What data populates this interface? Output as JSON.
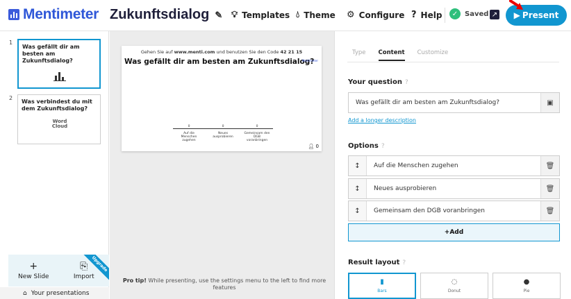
{
  "header": {
    "logo_text": "Mentimeter",
    "presentation_title": "Zukunftsdialog",
    "nav": {
      "templates": "Templates",
      "theme": "Theme",
      "configure": "Configure",
      "help": "Help"
    },
    "saved_label": "Saved",
    "present_label": "Present"
  },
  "sidebar": {
    "slides": [
      {
        "number": "1",
        "title": "Was gefällt dir am besten am Zukunftsdialog?"
      },
      {
        "number": "2",
        "title": "Was verbindest du mit dem Zukunftsdialog?",
        "wordcloud_label": "Word Cloud"
      }
    ],
    "new_slide": "New Slide",
    "import": "Import",
    "upgrade": "Upgrade",
    "your_presentations": "Your presentations"
  },
  "slide_preview": {
    "join_prefix": "Gehen Sie auf ",
    "join_url": "www.menti.com",
    "join_mid": " und benutzen Sie den Code ",
    "join_code": "42 21 15",
    "question": "Was gefällt dir am besten am Zukunftsdialog?",
    "menti_tag": "Mentimeter",
    "bars": [
      {
        "value": "0",
        "label": "Auf die Menschen zugehen"
      },
      {
        "value": "0",
        "label": "Neues ausprobieren"
      },
      {
        "value": "0",
        "label": "Gemeinsam den DGB voranbringen"
      }
    ],
    "participants": "0"
  },
  "pro_tip": {
    "bold": "Pro tip!",
    "text": " While presenting, use the settings menu to the left to find more features"
  },
  "panel": {
    "tabs": [
      "Type",
      "Content",
      "Customize"
    ],
    "your_question_label": "Your question",
    "question_value": "Was gefällt dir am besten am Zukunftsdialog?",
    "add_description": "Add a longer description",
    "options_label": "Options",
    "options": [
      "Auf die Menschen zugehen",
      "Neues ausprobieren",
      "Gemeinsam den DGB voranbringen"
    ],
    "add_label": "+Add",
    "result_layout_label": "Result layout",
    "layouts": [
      "Bars",
      "Donut",
      "Pie"
    ]
  },
  "colors": {
    "brand": "#2f57d8",
    "present_button": "#1196d0",
    "saved_check": "#2ebf7c"
  }
}
